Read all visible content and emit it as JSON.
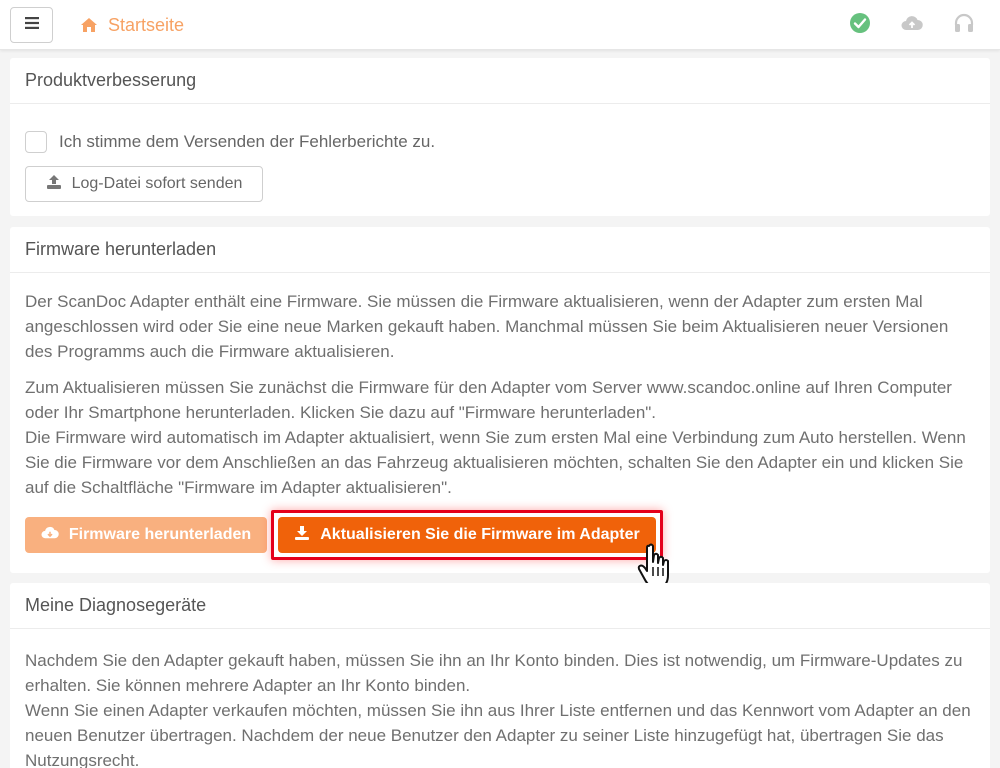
{
  "header": {
    "home_label": "Startseite"
  },
  "product_improvement": {
    "title": "Produktverbesserung",
    "consent_label": "Ich stimme dem Versenden der Fehlerberichte zu.",
    "consent_checked": false,
    "send_log_label": "Log-Datei sofort senden"
  },
  "firmware": {
    "title": "Firmware herunterladen",
    "paragraph1": "Der ScanDoc Adapter enthält eine Firmware. Sie müssen die Firmware aktualisieren, wenn der Adapter zum ersten Mal angeschlossen wird oder Sie eine neue Marken gekauft haben. Manchmal müssen Sie beim Aktualisieren neuer Versionen des Programms auch die Firmware aktualisieren.",
    "paragraph2_line1": "Zum Aktualisieren müssen Sie zunächst die Firmware für den Adapter vom Server www.scandoc.online auf Ihren Computer oder Ihr Smartphone herunterladen. Klicken Sie dazu auf \"Firmware herunterladen\".",
    "paragraph2_line2": "Die Firmware wird automatisch im Adapter aktualisiert, wenn Sie zum ersten Mal eine Verbindung zum Auto herstellen. Wenn Sie die Firmware vor dem Anschließen an das Fahrzeug aktualisieren möchten, schalten Sie den Adapter ein und klicken Sie auf die Schaltfläche \"Firmware im Adapter aktualisieren\".",
    "download_label": "Firmware herunterladen",
    "update_label": "Aktualisieren Sie die Firmware im Adapter"
  },
  "devices": {
    "title": "Meine Diagnosegeräte",
    "paragraph_line1": "Nachdem Sie den Adapter gekauft haben, müssen Sie ihn an Ihr Konto binden. Dies ist notwendig, um Firmware-Updates zu erhalten. Sie können mehrere Adapter an Ihr Konto binden.",
    "paragraph_line2": "Wenn Sie einen Adapter verkaufen möchten, müssen Sie ihn aus Ihrer Liste entfernen und das Kennwort vom Adapter an den neuen Benutzer übertragen. Nachdem der neue Benutzer den Adapter zu seiner Liste hinzugefügt hat, übertragen Sie das Nutzungsrecht."
  },
  "colors": {
    "accent": "#f0620a",
    "accent_light": "#f9b07f",
    "status_ok": "#66c17e",
    "highlight": "#e4001b"
  },
  "icons": [
    "hamburger-icon",
    "home-icon",
    "check-circle-icon",
    "cloud-upload-icon",
    "headset-icon",
    "upload-icon",
    "cloud-download-icon",
    "download-icon",
    "hand-pointer-icon"
  ]
}
